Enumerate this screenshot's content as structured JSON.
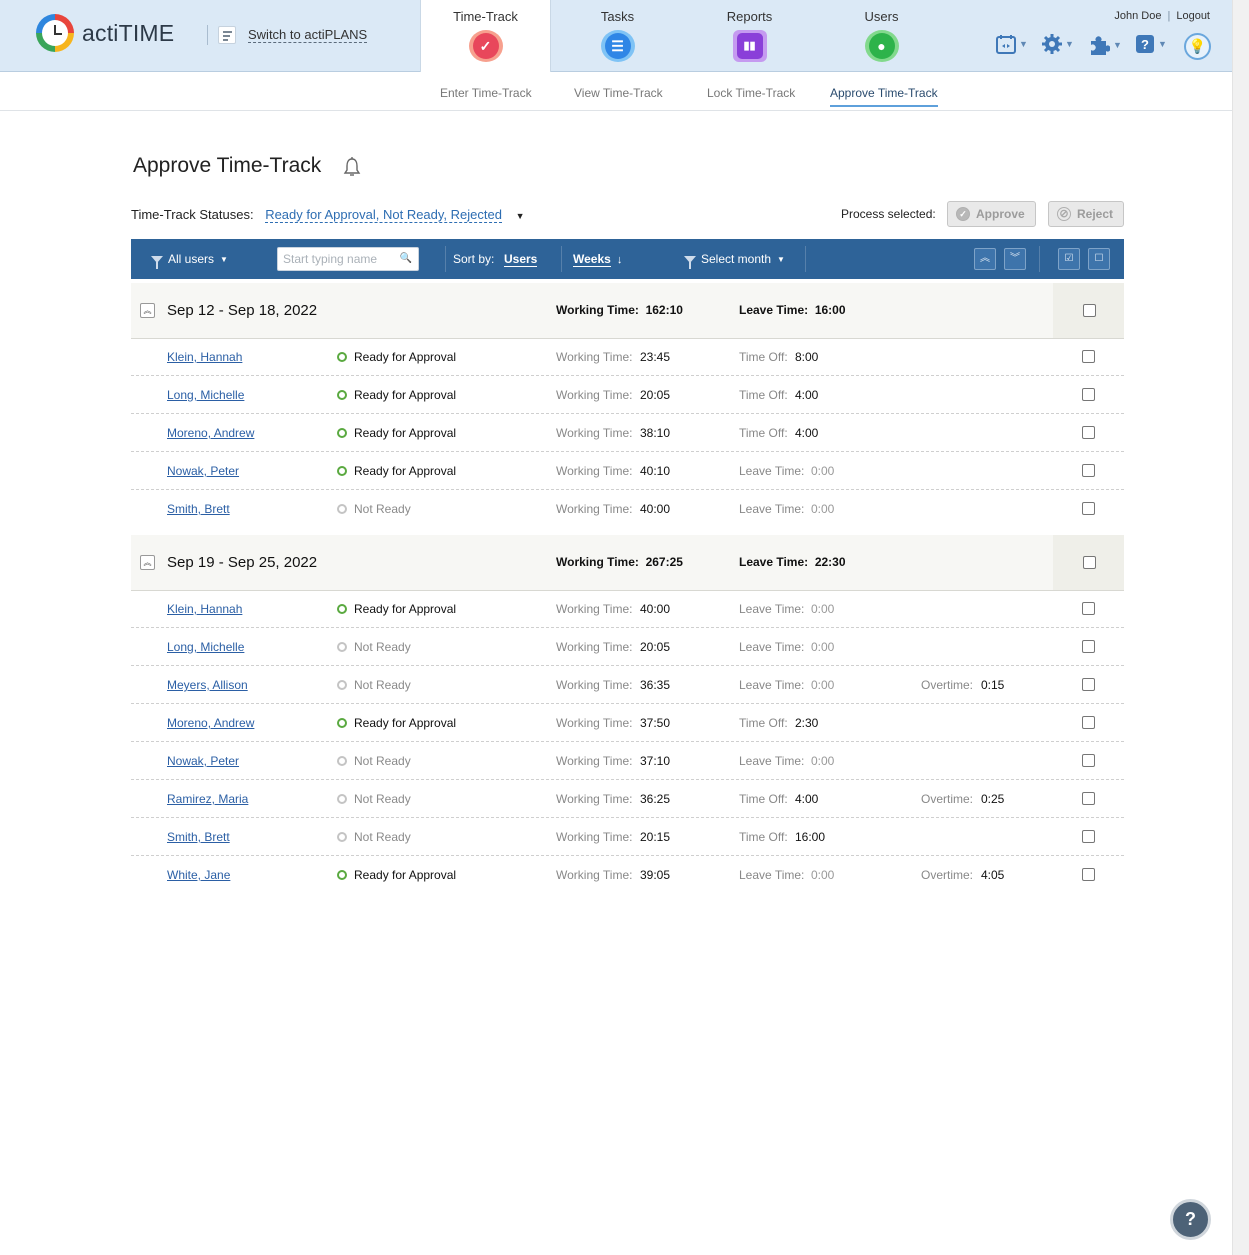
{
  "app": {
    "name": "actiTIME",
    "switch_label": "Switch to actiPLANS"
  },
  "nav_tabs": [
    {
      "label": "Time-Track"
    },
    {
      "label": "Tasks"
    },
    {
      "label": "Reports"
    },
    {
      "label": "Users"
    }
  ],
  "user": {
    "name": "John Doe",
    "logout": "Logout"
  },
  "subnav": [
    {
      "label": "Enter Time-Track"
    },
    {
      "label": "View Time-Track"
    },
    {
      "label": "Lock Time-Track"
    },
    {
      "label": "Approve Time-Track"
    }
  ],
  "page": {
    "title": "Approve Time-Track",
    "statuses_label": "Time-Track Statuses:",
    "statuses_value": "Ready for Approval, Not Ready, Rejected",
    "process_label": "Process selected:",
    "approve": "Approve",
    "reject": "Reject"
  },
  "toolbar": {
    "all_users": "All users",
    "search_placeholder": "Start typing name",
    "sort_by": "Sort by:",
    "sort_users": "Users",
    "sort_weeks": "Weeks",
    "select_month": "Select month"
  },
  "labels": {
    "working_time": "Working Time:",
    "leave_time": "Leave Time:",
    "time_off": "Time Off:",
    "overtime": "Overtime:"
  },
  "groups": [
    {
      "range": "Sep 12 - Sep 18, 2022",
      "working_time": "162:10",
      "leave_time": "16:00",
      "rows": [
        {
          "name": "Klein, Hannah",
          "status": "Ready for Approval",
          "working": "23:45",
          "leave_label": "Time Off:",
          "leave": "8:00",
          "overtime": ""
        },
        {
          "name": "Long, Michelle",
          "status": "Ready for Approval",
          "working": "20:05",
          "leave_label": "Time Off:",
          "leave": "4:00",
          "overtime": ""
        },
        {
          "name": "Moreno, Andrew",
          "status": "Ready for Approval",
          "working": "38:10",
          "leave_label": "Time Off:",
          "leave": "4:00",
          "overtime": ""
        },
        {
          "name": "Nowak, Peter",
          "status": "Ready for Approval",
          "working": "40:10",
          "leave_label": "Leave Time:",
          "leave": "0:00",
          "overtime": ""
        },
        {
          "name": "Smith, Brett",
          "status": "Not Ready",
          "working": "40:00",
          "leave_label": "Leave Time:",
          "leave": "0:00",
          "overtime": ""
        }
      ]
    },
    {
      "range": "Sep 19 - Sep 25, 2022",
      "working_time": "267:25",
      "leave_time": "22:30",
      "rows": [
        {
          "name": "Klein, Hannah",
          "status": "Ready for Approval",
          "working": "40:00",
          "leave_label": "Leave Time:",
          "leave": "0:00",
          "overtime": ""
        },
        {
          "name": "Long, Michelle",
          "status": "Not Ready",
          "working": "20:05",
          "leave_label": "Leave Time:",
          "leave": "0:00",
          "overtime": ""
        },
        {
          "name": "Meyers, Allison",
          "status": "Not Ready",
          "working": "36:35",
          "leave_label": "Leave Time:",
          "leave": "0:00",
          "overtime": "0:15"
        },
        {
          "name": "Moreno, Andrew",
          "status": "Ready for Approval",
          "working": "37:50",
          "leave_label": "Time Off:",
          "leave": "2:30",
          "overtime": ""
        },
        {
          "name": "Nowak, Peter",
          "status": "Not Ready",
          "working": "37:10",
          "leave_label": "Leave Time:",
          "leave": "0:00",
          "overtime": ""
        },
        {
          "name": "Ramirez, Maria",
          "status": "Not Ready",
          "working": "36:25",
          "leave_label": "Time Off:",
          "leave": "4:00",
          "overtime": "0:25"
        },
        {
          "name": "Smith, Brett",
          "status": "Not Ready",
          "working": "20:15",
          "leave_label": "Time Off:",
          "leave": "16:00",
          "overtime": ""
        },
        {
          "name": "White, Jane",
          "status": "Ready for Approval",
          "working": "39:05",
          "leave_label": "Leave Time:",
          "leave": "0:00",
          "overtime": "4:05"
        }
      ]
    }
  ],
  "colors": {
    "header_bg": "#dbe9f6",
    "toolbar_bg": "#2e6398",
    "link": "#2b5fa5",
    "ready": "#5aa940"
  },
  "help": "?"
}
